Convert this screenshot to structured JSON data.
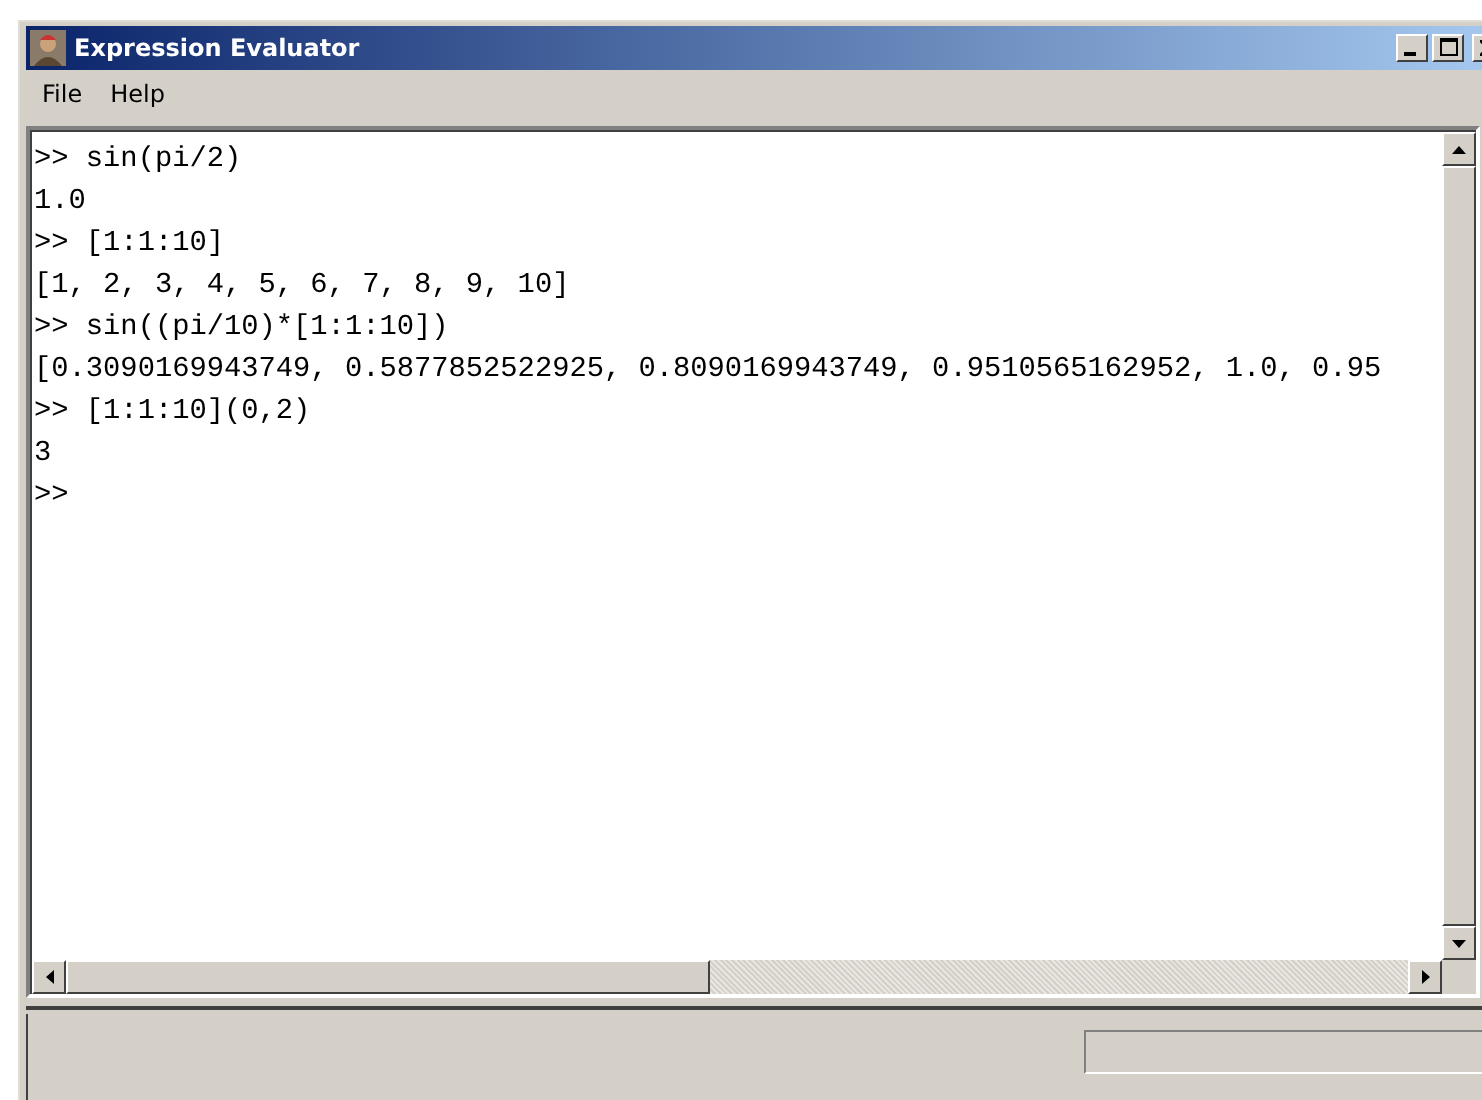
{
  "window": {
    "title": "Expression Evaluator"
  },
  "menu": [
    "File",
    "Help"
  ],
  "console_lines": [
    ">> sin(pi/2)",
    "1.0",
    ">> [1:1:10]",
    "[1, 2, 3, 4, 5, 6, 7, 8, 9, 10]",
    ">> sin((pi/10)*[1:1:10])",
    "[0.3090169943749, 0.5877852522925, 0.8090169943749, 0.9510565162952, 1.0, 0.95",
    ">> [1:1:10](0,2)",
    "3",
    ">>"
  ]
}
